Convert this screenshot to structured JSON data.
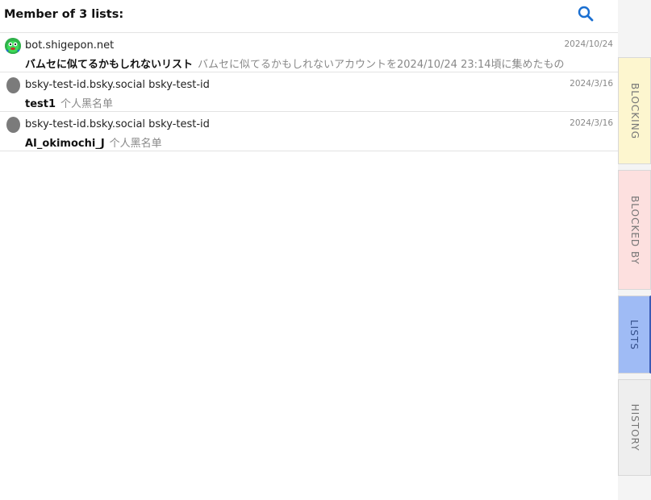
{
  "header": {
    "title": "Member of 3 lists:",
    "search_icon": "search-icon",
    "accent_color": "#1a6fd1"
  },
  "lists": [
    {
      "owner": "bot.shigepon.net",
      "date": "2024/10/24",
      "name": "バムセに似てるかもしれないリスト",
      "description": "バムセに似てるかもしれないアカウントを2024/10/24 23:14頃に集めたもの",
      "avatar": "green-character-avatar"
    },
    {
      "owner": "bsky-test-id.bsky.social bsky-test-id",
      "date": "2024/3/16",
      "name": "test1",
      "description": "个人黑名单",
      "avatar": "gray-avatar"
    },
    {
      "owner": "bsky-test-id.bsky.social bsky-test-id",
      "date": "2024/3/16",
      "name": "AI_okimochi_J",
      "description": "个人黑名单",
      "avatar": "gray-avatar"
    }
  ],
  "tabs": {
    "blocking": "BLOCKING",
    "blocked_by": "BLOCKED BY",
    "lists": "LISTS",
    "history": "HISTORY",
    "active": "LISTS"
  },
  "colors": {
    "blocking_bg": "#fdf6cf",
    "blocked_by_bg": "#fde0df",
    "lists_bg": "#9fbbf5",
    "history_bg": "#eeeeee"
  }
}
